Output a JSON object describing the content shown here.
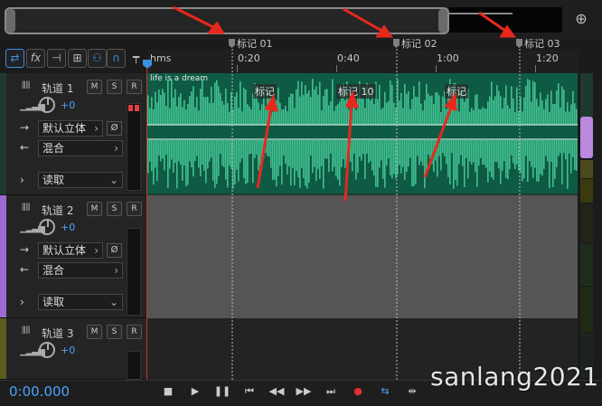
{
  "markers": [
    "标记 01",
    "标记 02",
    "标记 03"
  ],
  "ruler": {
    "unit": "hms",
    "ticks": [
      "0:20",
      "0:40",
      "1:00",
      "1:20"
    ]
  },
  "clip": {
    "title": "life is a dream",
    "markers": [
      "标记",
      "标记 10",
      "标记"
    ]
  },
  "tracks": [
    {
      "name": "轨道 1",
      "volume": "+0",
      "input": "默认立体",
      "output": "混合",
      "automation": "读取",
      "color": "#1e3a2f"
    },
    {
      "name": "轨道 2",
      "volume": "+0",
      "input": "默认立体",
      "output": "混合",
      "automation": "读取",
      "color": "#9b6bd3"
    },
    {
      "name": "轨道 3",
      "volume": "+0",
      "color": "#5e5a1e"
    }
  ],
  "buttons": {
    "mute": "M",
    "solo": "S",
    "record": "R",
    "phase": "Ø"
  },
  "transport": {
    "time": "0:00.000"
  },
  "watermark": "sanlang2021",
  "icons": [
    "loop-icon",
    "fx-icon",
    "send-icon",
    "eq-icon",
    "record-arm-icon",
    "magnet-icon",
    "pin-icon",
    "zoom-icon"
  ]
}
